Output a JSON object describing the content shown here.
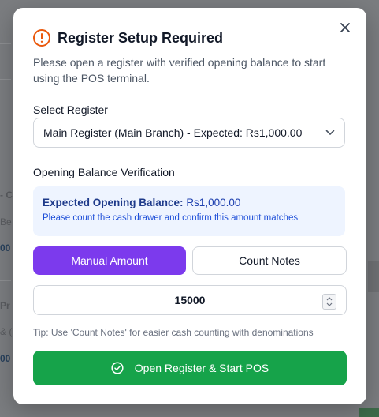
{
  "background": {
    "fragments": [
      "- C",
      "Be",
      "00",
      "Pr",
      "& (",
      "00"
    ]
  },
  "modal": {
    "title": "Register Setup Required",
    "description": "Please open a register with verified opening balance to start using the POS terminal.",
    "close_icon": "close-icon",
    "alert_icon": "alert-circle-icon"
  },
  "register": {
    "label": "Select Register",
    "selected": "Main Register (Main Branch) - Expected: Rs1,000.00"
  },
  "verification": {
    "label": "Opening Balance Verification",
    "expected_label": "Expected Opening Balance:",
    "expected_value": "Rs1,000.00",
    "hint": "Please count the cash drawer and confirm this amount matches"
  },
  "mode_tabs": {
    "manual": "Manual Amount",
    "count": "Count Notes",
    "active": "manual"
  },
  "amount": {
    "value": "15000"
  },
  "tip": "Tip: Use 'Count Notes' for easier cash counting with denominations",
  "submit": {
    "label": "Open Register & Start POS",
    "icon": "check-circle-icon"
  },
  "colors": {
    "accent_purple": "#7c3aed",
    "success_green": "#16a34a",
    "alert_orange": "#ea580c",
    "info_bg": "#eef4ff"
  }
}
